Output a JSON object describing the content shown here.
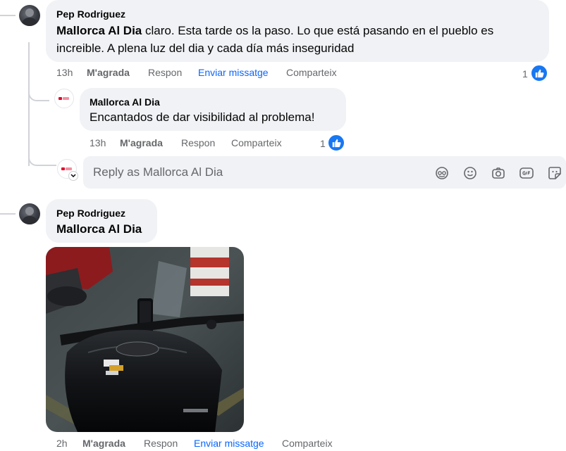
{
  "comment1": {
    "author": "Pep Rodriguez",
    "tag": "Mallorca Al Dia",
    "line1_rest": " claro. Esta tarde os la paso. Lo que está pasando en el pueblo es",
    "line2": "increible. A plena luz del dia y cada día más inseguridad",
    "time": "13h",
    "like_label": "M'agrada",
    "reply_label": "Respon",
    "message_label": "Enviar missatge",
    "share_label": "Comparteix",
    "reaction_count": "1"
  },
  "reply1": {
    "author": "Mallorca Al Dia",
    "text": "Encantados de dar visibilidad al problema!",
    "time": "13h",
    "like_label": "M'agrada",
    "reply_label": "Respon",
    "share_label": "Comparteix",
    "reaction_count": "1"
  },
  "reply_box": {
    "placeholder": "Reply as Mallorca Al Dia",
    "tools": [
      "avatar-sticker-icon",
      "emoji-icon",
      "camera-icon",
      "gif-icon",
      "sticker-icon"
    ]
  },
  "comment2": {
    "author": "Pep Rodriguez",
    "text": "Mallorca Al Dia",
    "time": "2h",
    "like_label": "M'agrada",
    "reply_label": "Respon",
    "message_label": "Enviar missatge",
    "share_label": "Comparteix"
  },
  "colors": {
    "accent": "#0866ff",
    "like_badge": "#1877f2",
    "bubble": "#f0f2f5",
    "secondary_text": "#65676b"
  }
}
